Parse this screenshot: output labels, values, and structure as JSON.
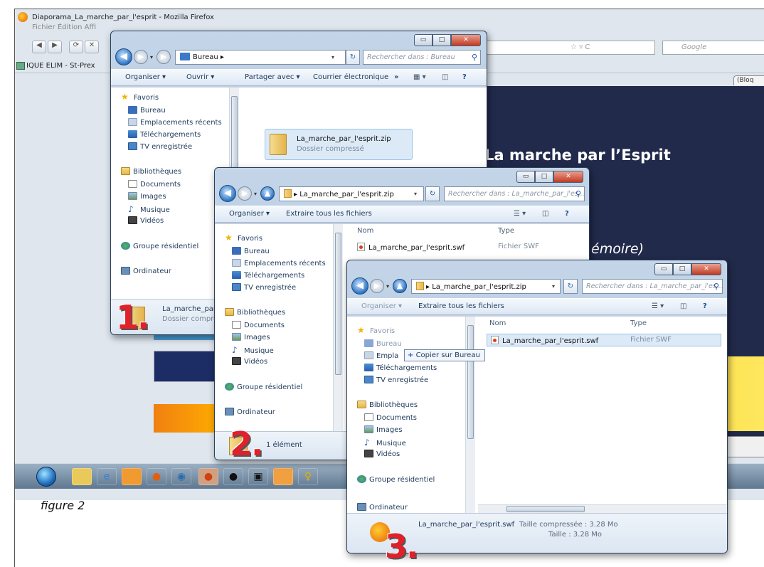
{
  "firefox": {
    "title": "Diaporama_La_marche_par_l'esprit - Mozilla Firefox",
    "menu": "Fichier  Édition  Affi",
    "search_placeholder": "Google",
    "bookmark": "IQUE ELIM - St-Prex",
    "tab_label": "(Bloq",
    "page_heading": "La marche par l’Esprit",
    "page_sub": "émoire)"
  },
  "caption": "figure 2",
  "win1": {
    "address": "Bureau",
    "search_placeholder": "Rechercher dans : Bureau",
    "cmd": {
      "organize": "Organiser ▾",
      "open": "Ouvrir ▾",
      "share": "Partager avec ▾",
      "mail": "Courrier électronique",
      "more": "»"
    },
    "nav": {
      "favorites": "Favoris",
      "desktop": "Bureau",
      "recent": "Emplacements récents",
      "downloads": "Téléchargements",
      "tv": "TV enregistrée",
      "libraries": "Bibliothèques",
      "documents": "Documents",
      "images": "Images",
      "music": "Musique",
      "videos": "Vidéos",
      "homegroup": "Groupe résidentiel",
      "computer": "Ordinateur"
    },
    "file": {
      "name": "La_marche_par_l'esprit.zip",
      "type": "Dossier compressé"
    },
    "details": {
      "name": "La_marche_par",
      "type": "Dossier compres"
    },
    "step": "1."
  },
  "win2": {
    "address": "La_marche_par_l'esprit.zip",
    "search_placeholder": "Rechercher dans : La_marche_par_l'es...",
    "cmd": {
      "organize": "Organiser ▾",
      "extract": "Extraire tous les fichiers"
    },
    "nav": {
      "favorites": "Favoris",
      "desktop": "Bureau",
      "recent": "Emplacements récents",
      "downloads": "Téléchargements",
      "tv": "TV enregistrée",
      "libraries": "Bibliothèques",
      "documents": "Documents",
      "images": "Images",
      "music": "Musique",
      "videos": "Vidéos",
      "homegroup": "Groupe résidentiel",
      "computer": "Ordinateur"
    },
    "columns": {
      "name": "Nom",
      "type": "Type"
    },
    "file": {
      "name": "La_marche_par_l'esprit.swf",
      "type": "Fichier SWF"
    },
    "details": "1 élément",
    "step": "2."
  },
  "win3": {
    "address": "La_marche_par_l'esprit.zip",
    "search_placeholder": "Rechercher dans : La_marche_par_l'es...",
    "cmd": {
      "organize": "Organiser ▾",
      "extract": "Extraire tous les fichiers"
    },
    "nav": {
      "favorites": "Favoris",
      "desktop": "Bureau",
      "recent": "Empla",
      "downloads": "Téléchargements",
      "tv": "TV enregistrée",
      "libraries": "Bibliothèques",
      "documents": "Documents",
      "images": "Images",
      "music": "Musique",
      "videos": "Vidéos",
      "homegroup": "Groupe résidentiel",
      "computer": "Ordinateur"
    },
    "tooltip": "Copier sur Bureau",
    "columns": {
      "name": "Nom",
      "type": "Type"
    },
    "file": {
      "name": "La_marche_par_l'esprit.swf",
      "type": "Fichier SWF"
    },
    "details": {
      "name": "La_marche_par_l'esprit.swf",
      "compressed_label": "Taille compressée : 3.28 Mo",
      "size_label": "Taille : 3.28 Mo"
    },
    "step": "3."
  },
  "colors": {
    "accent": "#e0202a",
    "page_bg": "#222a4c",
    "yellow": "#f6c500"
  }
}
